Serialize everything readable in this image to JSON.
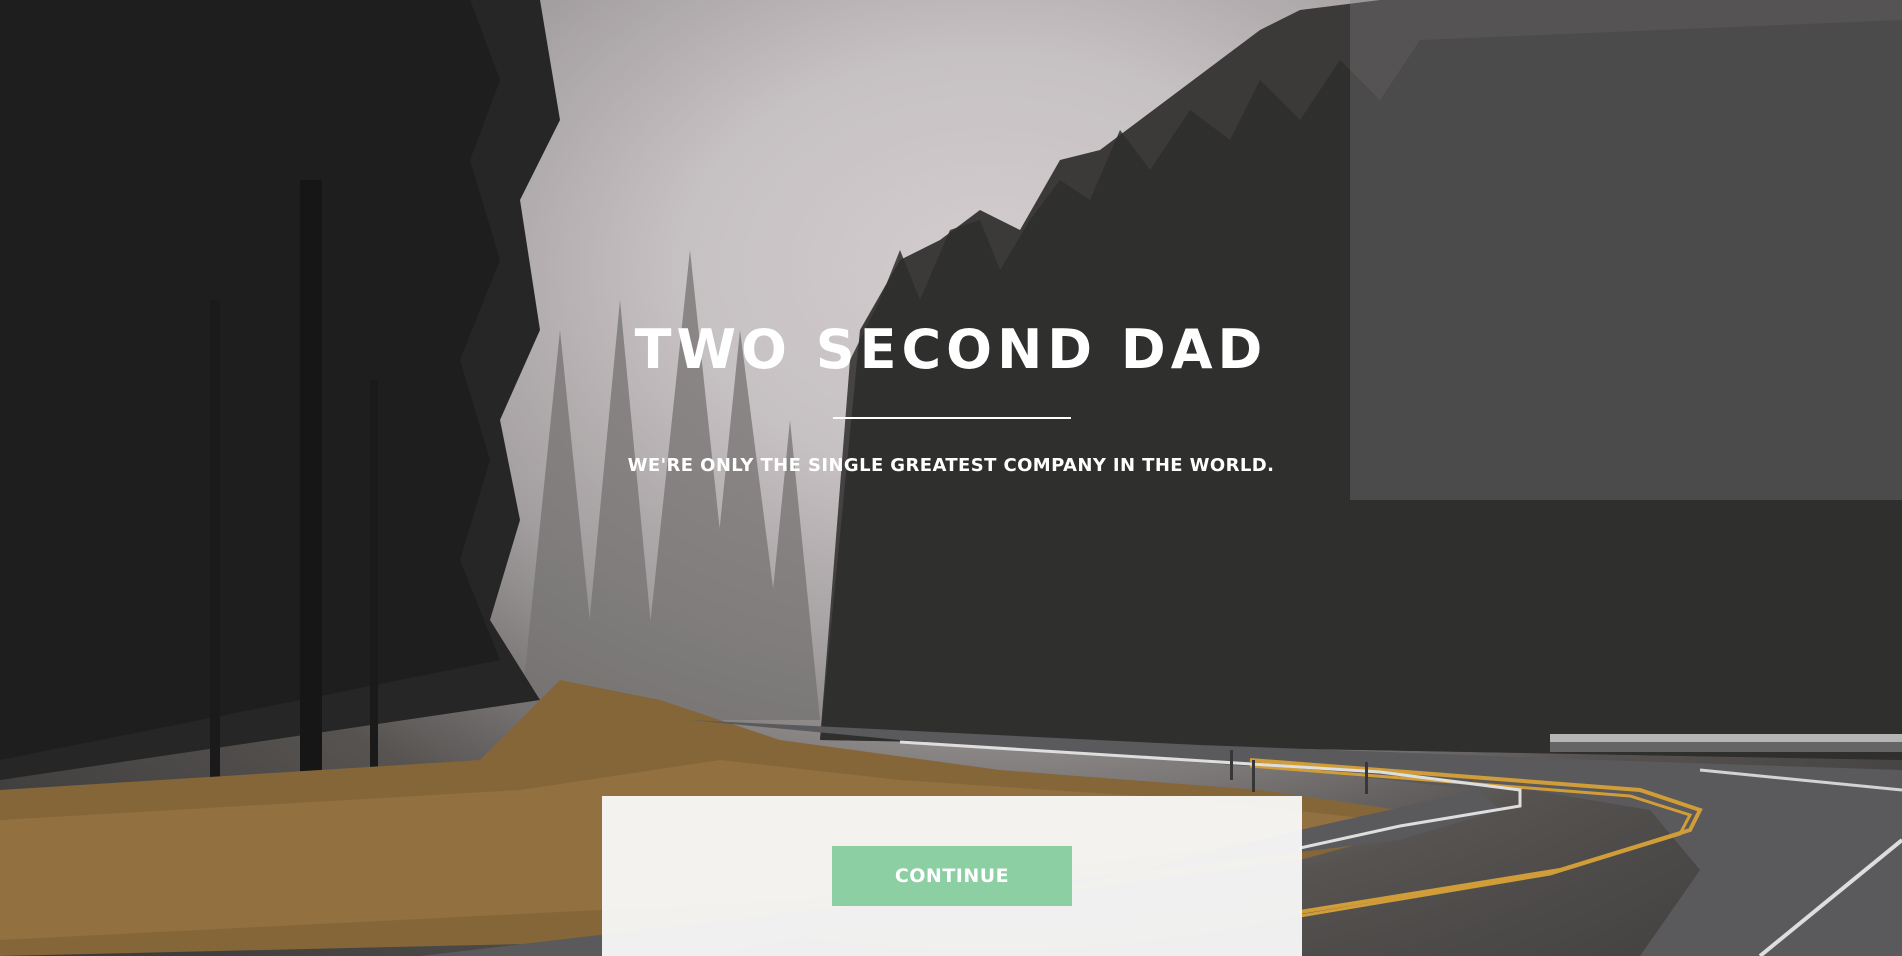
{
  "hero": {
    "title": "TWO SECOND DAD",
    "subtitle": "WE'RE ONLY THE SINGLE GREATEST COMPANY IN THE WORLD."
  },
  "cta": {
    "continue_label": "CONTINUE"
  },
  "colors": {
    "cta_background": "#8bcfa3",
    "text": "#ffffff",
    "panel": "#fafafa"
  },
  "background": {
    "image_description_icon": "forest-road-background"
  }
}
